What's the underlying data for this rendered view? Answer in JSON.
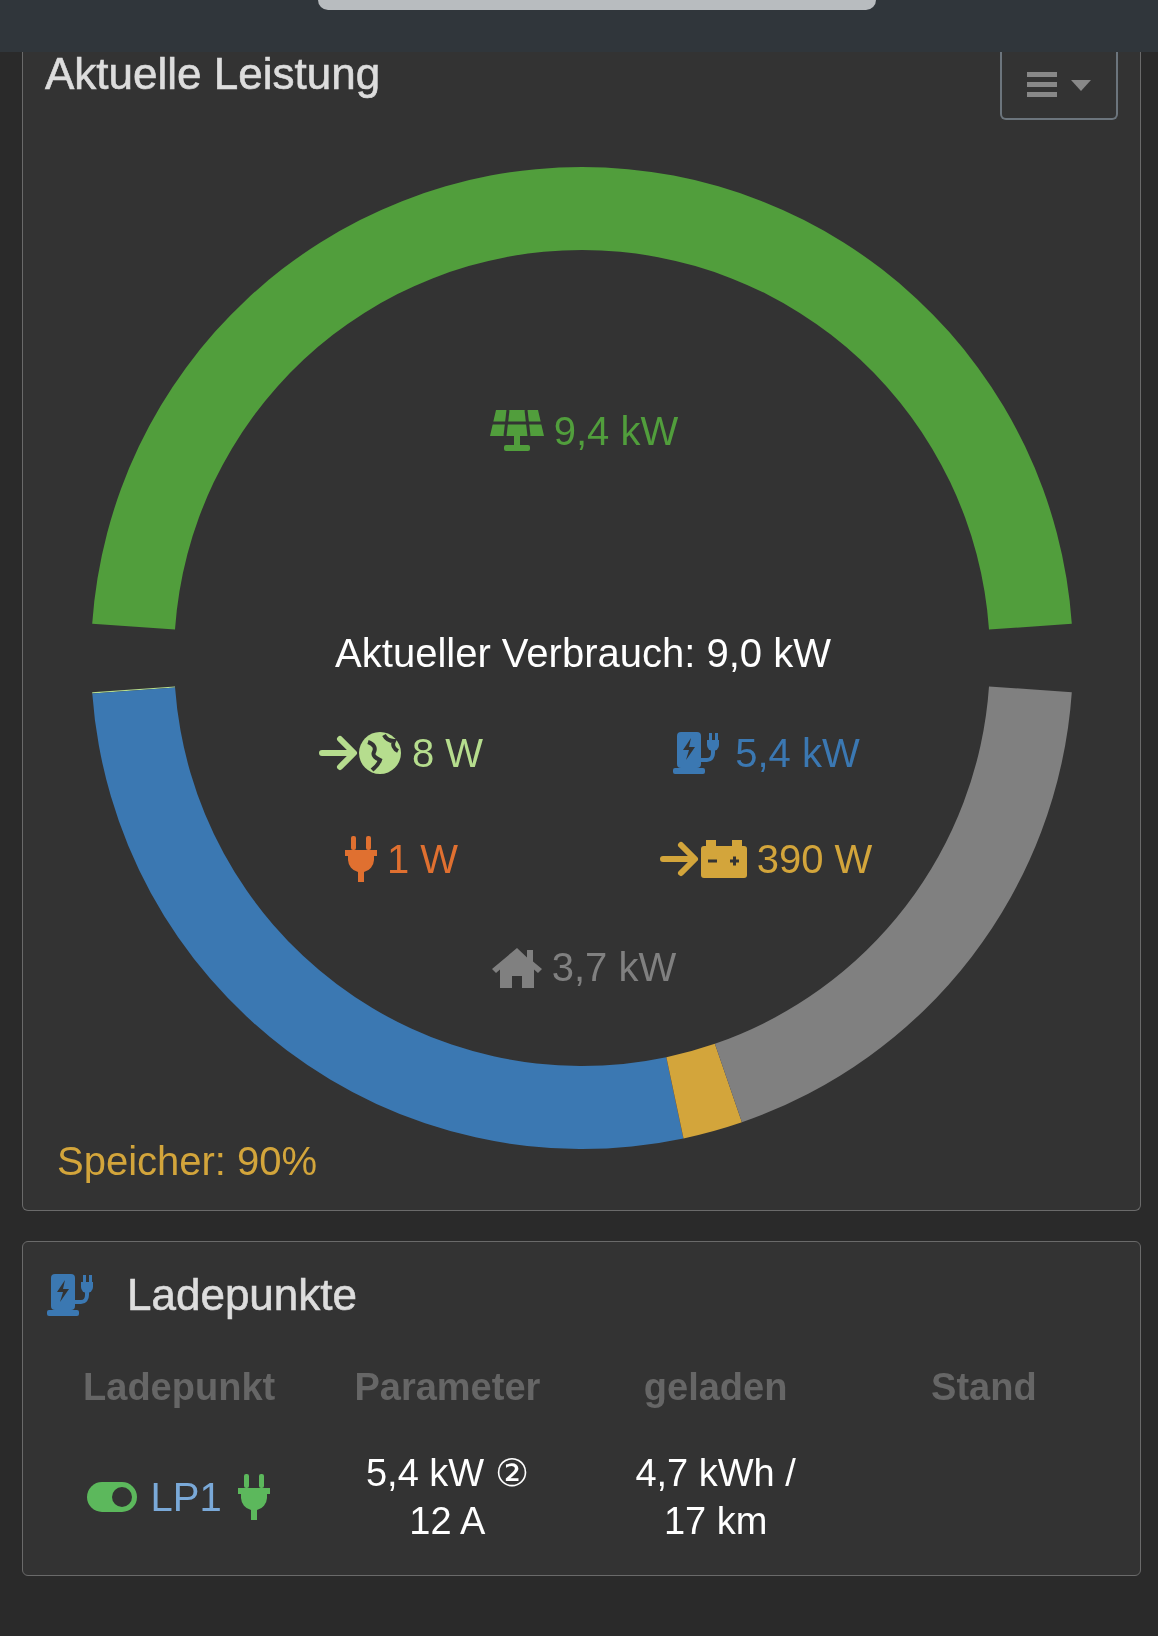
{
  "power_card": {
    "title": "Aktuelle Leistung",
    "usage_ring": {
      "chart_data": {
        "type": "donut",
        "values": [
          0.08,
          56.85,
          0.01,
          4.11,
          38.95
        ],
        "colors": [
          "#b6dd8e",
          "#3b78b2",
          "#e07030",
          "#d3a53b",
          "#808080"
        ]
      }
    },
    "consumption": "Aktueller Verbrauch: 9,0 kW",
    "flows": [
      {
        "kind": "pv",
        "value": "9,4 kW",
        "color": "#519e3c"
      },
      {
        "kind": "grid",
        "value": "8 W",
        "color": "#b6dd8e"
      },
      {
        "kind": "charging",
        "value": "5,4 kW",
        "color": "#3b78b2"
      },
      {
        "kind": "devices",
        "value": "1 W",
        "color": "#e07030"
      },
      {
        "kind": "battery",
        "value": "390 W",
        "color": "#d3a53b"
      },
      {
        "kind": "house",
        "value": "3,7 kW",
        "color": "#808080"
      }
    ],
    "storage": "Speicher: 90%"
  },
  "charge_card": {
    "title": "Ladepunkte",
    "table": {
      "columns": [
        "Ladepunkt",
        "Parameter",
        "geladen",
        "Stand"
      ],
      "rows": [
        {
          "enabled": true,
          "name": "LP1",
          "plugged": true,
          "parameter": "5,4 kW ② 12 A",
          "charged": "4,7 kWh / 17 km"
        }
      ]
    }
  }
}
